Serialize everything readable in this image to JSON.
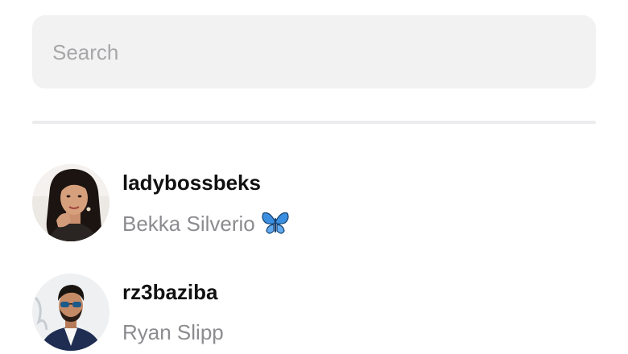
{
  "search": {
    "placeholder": "Search",
    "value": ""
  },
  "results": [
    {
      "username": "ladybossbeks",
      "full_name": "Bekka Silverio",
      "name_suffix_icon": "blue-butterfly-emoji"
    },
    {
      "username": "rz3baziba",
      "full_name": "Ryan Slipp"
    }
  ],
  "colors": {
    "search_bg": "#f2f2f3",
    "placeholder": "#a7a7aa",
    "username": "#111111",
    "full_name": "#8c8c90",
    "butterfly": "#3b8fe0"
  }
}
